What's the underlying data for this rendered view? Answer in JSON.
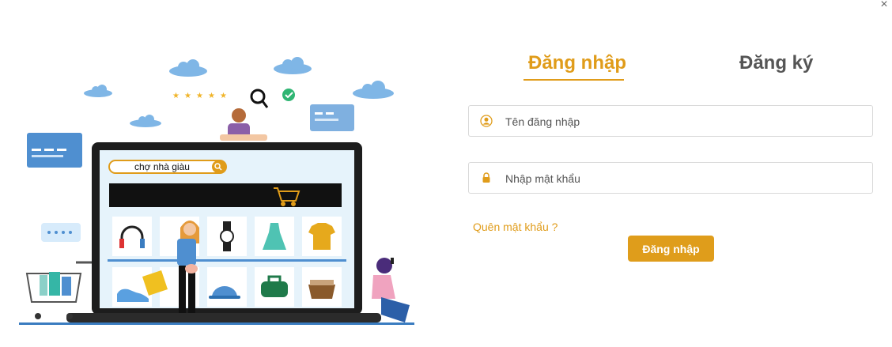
{
  "dialog": {
    "close_icon": "close-icon",
    "close_label": "×"
  },
  "illustration": {
    "search_text": "chợ nhà giàu"
  },
  "tabs": [
    {
      "label": "Đăng nhập",
      "active": true
    },
    {
      "label": "Đăng ký",
      "active": false
    }
  ],
  "form": {
    "username": {
      "placeholder": "Tên đăng nhập",
      "value": "",
      "icon": "user-icon"
    },
    "password": {
      "placeholder": "Nhập mật khẩu",
      "value": "",
      "icon": "lock-icon"
    },
    "forgot_label": "Quên mật khẩu ?",
    "submit_label": "Đăng nhập"
  },
  "colors": {
    "accent": "#E09C1A",
    "inactive_tab": "#555555",
    "border": "#D9D9D9"
  }
}
